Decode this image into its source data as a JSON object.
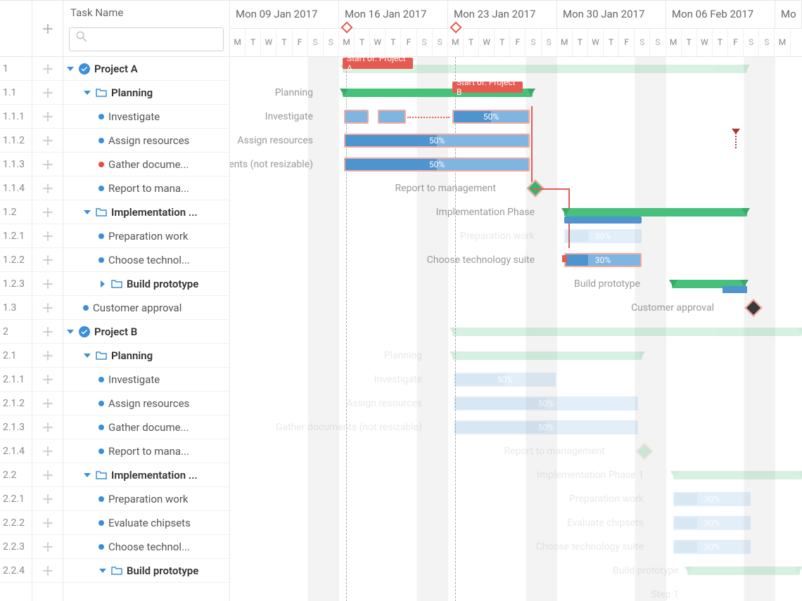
{
  "header": {
    "task_name_label": "Task Name",
    "search_placeholder": ""
  },
  "weeks": [
    "Mon 09 Jan 2017",
    "Mon 16 Jan 2017",
    "Mon 23 Jan 2017",
    "Mon 30 Jan 2017",
    "Mon 06 Feb 2017",
    "Mo"
  ],
  "day_pattern": [
    "M",
    "T",
    "W",
    "T",
    "F",
    "S",
    "S"
  ],
  "tasks": [
    {
      "wbs": "1",
      "label": "Project A",
      "indent": 0,
      "bold": true,
      "icon": "check",
      "expanded": true
    },
    {
      "wbs": "1.1",
      "label": "Planning",
      "indent": 1,
      "bold": true,
      "icon": "folder",
      "expanded": true
    },
    {
      "wbs": "1.1.1",
      "label": "Investigate",
      "indent": 2,
      "bullet": "blue"
    },
    {
      "wbs": "1.1.2",
      "label": "Assign resources",
      "indent": 2,
      "bullet": "blue"
    },
    {
      "wbs": "1.1.3",
      "label": "Gather docume...",
      "indent": 2,
      "bullet": "red"
    },
    {
      "wbs": "1.1.4",
      "label": "Report to mana...",
      "indent": 2,
      "bullet": "blue"
    },
    {
      "wbs": "1.2",
      "label": "Implementation ...",
      "indent": 1,
      "bold": true,
      "icon": "folder",
      "expanded": true
    },
    {
      "wbs": "1.2.1",
      "label": "Preparation work",
      "indent": 2,
      "bullet": "blue"
    },
    {
      "wbs": "1.2.2",
      "label": "Choose technol...",
      "indent": 2,
      "bullet": "blue"
    },
    {
      "wbs": "1.2.3",
      "label": "Build prototype",
      "indent": 2,
      "bold": true,
      "icon": "folder",
      "expanded": false
    },
    {
      "wbs": "1.3",
      "label": "Customer approval",
      "indent": 1,
      "bullet": "blue"
    },
    {
      "wbs": "2",
      "label": "Project B",
      "indent": 0,
      "bold": true,
      "icon": "check",
      "expanded": true
    },
    {
      "wbs": "2.1",
      "label": "Planning",
      "indent": 1,
      "bold": true,
      "icon": "folder",
      "expanded": true
    },
    {
      "wbs": "2.1.1",
      "label": "Investigate",
      "indent": 2,
      "bullet": "blue"
    },
    {
      "wbs": "2.1.2",
      "label": "Assign resources",
      "indent": 2,
      "bullet": "blue"
    },
    {
      "wbs": "2.1.3",
      "label": "Gather docume...",
      "indent": 2,
      "bullet": "blue"
    },
    {
      "wbs": "2.1.4",
      "label": "Report to mana...",
      "indent": 2,
      "bullet": "blue"
    },
    {
      "wbs": "2.2",
      "label": "Implementation ...",
      "indent": 1,
      "bold": true,
      "icon": "folder",
      "expanded": true
    },
    {
      "wbs": "2.2.1",
      "label": "Preparation work",
      "indent": 2,
      "bullet": "blue"
    },
    {
      "wbs": "2.2.2",
      "label": "Evaluate chipsets",
      "indent": 2,
      "bullet": "blue"
    },
    {
      "wbs": "2.2.3",
      "label": "Choose technol...",
      "indent": 2,
      "bullet": "blue"
    },
    {
      "wbs": "2.2.4",
      "label": "Build prototype",
      "indent": 2,
      "bold": true,
      "icon": "folder",
      "expanded": true
    }
  ],
  "gantt": {
    "labels": {
      "planning_a": "Planning",
      "investigate_a": "Investigate",
      "assign_a": "Assign resources",
      "gather_a": "ents (not resizable)",
      "report_a": "Report to management",
      "impl_a": "Implementation Phase",
      "prep_a": "Preparation work",
      "choose_a": "Choose technology suite",
      "build_a": "Build prototype",
      "cust_a": "Customer approval",
      "planning_b": "Planning",
      "investigate_b": "Investigate",
      "assign_b": "Assign resources",
      "gather_b": "Gather documents (not resizable)",
      "report_b": "Report to management",
      "impl_b": "Implementation Phase 1",
      "prep_b": "Preparation work",
      "eval_b": "Evaluate chipsets",
      "choose_b": "Choose technology suite",
      "build_b": "Build prototype",
      "step1_b": "Step 1"
    },
    "constraints": {
      "start_a": "Start of: Project A",
      "start_b": "Start of: Project B"
    },
    "pct": {
      "p50": "50%",
      "p30": "30%"
    }
  },
  "chart_data": {
    "type": "gantt",
    "title": "",
    "time_axis_start": "2017-01-09",
    "time_axis_end": "2017-02-13",
    "tick_unit": "week",
    "ticks": [
      "2017-01-09",
      "2017-01-16",
      "2017-01-23",
      "2017-01-30",
      "2017-02-06"
    ],
    "tasks": [
      {
        "id": "1",
        "name": "Project A",
        "type": "summary",
        "start": "2017-01-09",
        "end": "2017-02-07",
        "constraint": "Start of: Project A"
      },
      {
        "id": "1.1",
        "name": "Planning",
        "type": "summary",
        "start": "2017-01-09",
        "end": "2017-01-26"
      },
      {
        "id": "1.1.1",
        "name": "Investigate",
        "type": "task",
        "start": "2017-01-16",
        "end": "2017-01-27",
        "percent": 50
      },
      {
        "id": "1.1.2",
        "name": "Assign resources",
        "type": "task",
        "start": "2017-01-16",
        "end": "2017-01-27",
        "percent": 50
      },
      {
        "id": "1.1.3",
        "name": "Gather documents (not resizable)",
        "type": "task",
        "start": "2017-01-16",
        "end": "2017-01-27",
        "percent": 50,
        "resizable": false
      },
      {
        "id": "1.1.4",
        "name": "Report to management",
        "type": "milestone",
        "date": "2017-01-27"
      },
      {
        "id": "1.2",
        "name": "Implementation Phase",
        "type": "summary",
        "start": "2017-01-30",
        "end": "2017-02-07"
      },
      {
        "id": "1.2.1",
        "name": "Preparation work",
        "type": "task",
        "start": "2017-01-30",
        "end": "2017-02-03",
        "percent": 30
      },
      {
        "id": "1.2.2",
        "name": "Choose technology suite",
        "type": "task",
        "start": "2017-01-30",
        "end": "2017-02-03",
        "percent": 30
      },
      {
        "id": "1.2.3",
        "name": "Build prototype",
        "type": "summary",
        "start": "2017-02-06",
        "end": "2017-02-08"
      },
      {
        "id": "1.3",
        "name": "Customer approval",
        "type": "milestone",
        "date": "2017-02-08"
      },
      {
        "id": "2",
        "name": "Project B",
        "type": "summary",
        "start": "2017-01-16",
        "end": "2017-02-13",
        "constraint": "Start of: Project B"
      },
      {
        "id": "2.1",
        "name": "Planning",
        "type": "summary",
        "start": "2017-01-16",
        "end": "2017-02-02"
      },
      {
        "id": "2.1.1",
        "name": "Investigate",
        "type": "task",
        "start": "2017-01-23",
        "end": "2017-01-30",
        "percent": 50
      },
      {
        "id": "2.1.2",
        "name": "Assign resources",
        "type": "task",
        "start": "2017-01-23",
        "end": "2017-02-02",
        "percent": 50
      },
      {
        "id": "2.1.3",
        "name": "Gather documents (not resizable)",
        "type": "task",
        "start": "2017-01-23",
        "end": "2017-02-02",
        "percent": 50
      },
      {
        "id": "2.1.4",
        "name": "Report to management",
        "type": "milestone",
        "date": "2017-02-02"
      },
      {
        "id": "2.2",
        "name": "Implementation Phase 1",
        "type": "summary",
        "start": "2017-02-06",
        "end": "2017-02-13"
      },
      {
        "id": "2.2.1",
        "name": "Preparation work",
        "type": "task",
        "start": "2017-02-06",
        "end": "2017-02-10",
        "percent": 30
      },
      {
        "id": "2.2.2",
        "name": "Evaluate chipsets",
        "type": "task",
        "start": "2017-02-06",
        "end": "2017-02-10",
        "percent": 30
      },
      {
        "id": "2.2.3",
        "name": "Choose technology suite",
        "type": "task",
        "start": "2017-02-06",
        "end": "2017-02-10",
        "percent": 30
      },
      {
        "id": "2.2.4",
        "name": "Build prototype",
        "type": "summary",
        "start": "2017-02-09",
        "end": "2017-02-13"
      }
    ],
    "dependencies": [
      {
        "from": "1.1.4",
        "to": "1.2.1"
      },
      {
        "from": "1.1.4",
        "to": "1.2.2"
      },
      {
        "from": "1.1.1",
        "to": "1.1.4"
      },
      {
        "from": "1.1.2",
        "to": "1.1.4"
      },
      {
        "from": "1.1.3",
        "to": "1.1.4"
      }
    ],
    "deadlines": [
      {
        "task": "1.1.2",
        "date": "2017-02-07"
      }
    ]
  }
}
